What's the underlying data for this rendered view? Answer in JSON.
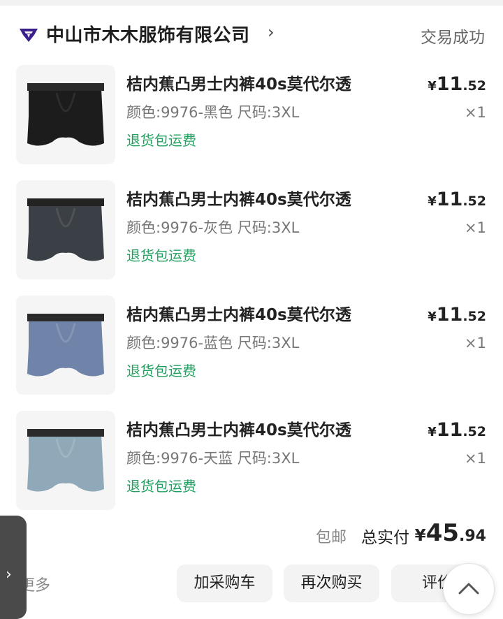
{
  "shop": {
    "name": "中山市木木服饰有限公司",
    "chevron": "›",
    "status": "交易成功",
    "logo_icon": "shop-brand-icon",
    "logo_color": "#3b1f8c"
  },
  "items": [
    {
      "title": "桔内蕉凸男士内裤40s莫代尔透",
      "spec": "颜色:9976-黑色 尺码:3XL",
      "service": "退货包运费",
      "price_symbol": "¥",
      "price_int": "11",
      "price_dec": ".52",
      "qty": "×1",
      "fabric_color": "#1c1c1c",
      "band_color": "#2a2a2a"
    },
    {
      "title": "桔内蕉凸男士内裤40s莫代尔透",
      "spec": "颜色:9976-灰色 尺码:3XL",
      "service": "退货包运费",
      "price_symbol": "¥",
      "price_int": "11",
      "price_dec": ".52",
      "qty": "×1",
      "fabric_color": "#3b4046",
      "band_color": "#232323"
    },
    {
      "title": "桔内蕉凸男士内裤40s莫代尔透",
      "spec": "颜色:9976-蓝色 尺码:3XL",
      "service": "退货包运费",
      "price_symbol": "¥",
      "price_int": "11",
      "price_dec": ".52",
      "qty": "×1",
      "fabric_color": "#6f84a8",
      "band_color": "#2b2b2b"
    },
    {
      "title": "桔内蕉凸男士内裤40s莫代尔透",
      "spec": "颜色:9976-天蓝 尺码:3XL",
      "service": "退货包运费",
      "price_symbol": "¥",
      "price_int": "11",
      "price_dec": ".52",
      "qty": "×1",
      "fabric_color": "#8fa9b8",
      "band_color": "#2b2b2b"
    }
  ],
  "summary": {
    "free_shipping": "包邮",
    "total_label": "总实付",
    "total_symbol": "¥",
    "total_int": "45",
    "total_dec": ".94"
  },
  "actions": {
    "more": "更多",
    "add_cart": "加采购车",
    "buy_again": "再次购买",
    "review": "评价"
  },
  "icons": {
    "side_tab": "chevron-right-icon",
    "back_to_top": "chevron-up-icon"
  },
  "colors": {
    "service_green": "#22a060",
    "muted_text": "#777777"
  }
}
